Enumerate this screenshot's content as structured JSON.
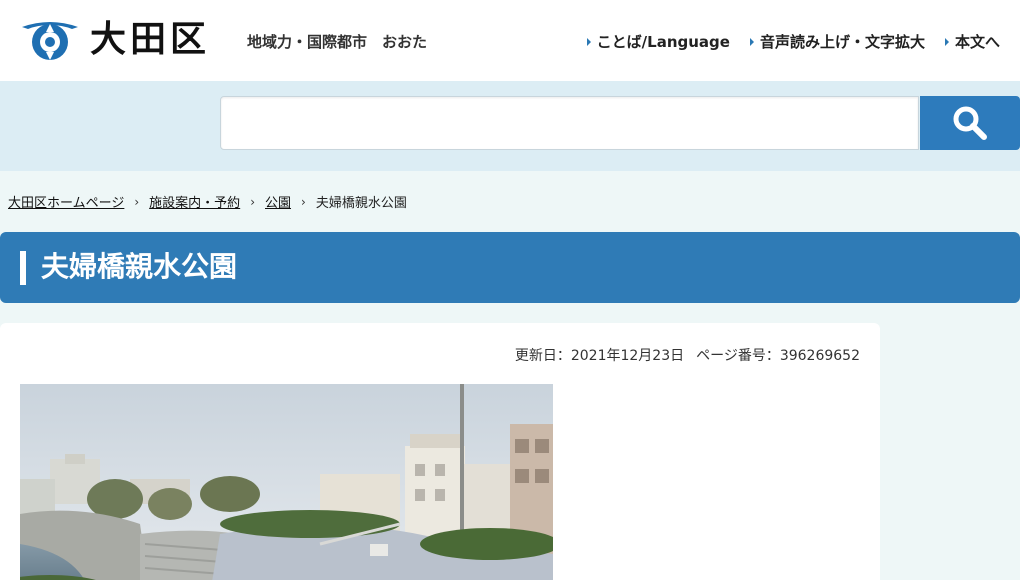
{
  "header": {
    "site_name": "大田区",
    "links": [
      "地域力・国際都市",
      "おおた"
    ],
    "util_nav": [
      "ことば/Language",
      "音声読み上げ・文字拡大",
      "本文へ"
    ]
  },
  "search": {
    "placeholder": "",
    "button_icon": "search-icon"
  },
  "breadcrumb": {
    "items": [
      "大田区ホームページ",
      "施設案内・予約",
      "公園"
    ],
    "current": "夫婦橋親水公園"
  },
  "page": {
    "title": "夫婦橋親水公園",
    "updated": "更新日：2021年12月23日",
    "page_number": "ページ番号：396269652"
  },
  "colors": {
    "accent": "#2f7bb6",
    "search_band": "#dcedf4",
    "background": "#eef7f7"
  }
}
